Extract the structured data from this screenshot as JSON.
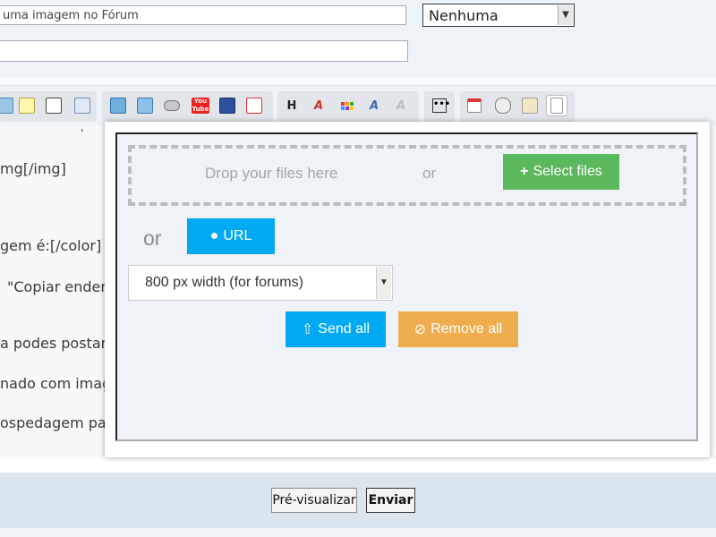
{
  "form": {
    "subject_value": "uma imagem no Fórum",
    "icon_select_value": "Nenhuma",
    "description_value": ""
  },
  "toolbar": {
    "heading_glyph": "H",
    "youtube_label": "You Tube"
  },
  "editor_lines": [
    "'",
    "mg[/img]",
    "gem é:[/color]",
    "\"Copiar endere",
    "a podes postar",
    "nado com image",
    "ospedagem pad"
  ],
  "uploader": {
    "drop_text": "Drop your files here",
    "or_text_1": "or",
    "select_files_label": "Select files",
    "or_text_2": "or",
    "url_label": "URL",
    "width_select_value": "800 px width (for forums)",
    "send_all_label": "Send all",
    "remove_all_label": "Remove all",
    "colors": {
      "select_files": "#5cb85c",
      "url": "#00a9f2",
      "send_all": "#00a9f2",
      "remove_all": "#f0ad4e"
    }
  },
  "footer": {
    "preview_label": "Pré-visualizar",
    "submit_label": "Enviar"
  }
}
